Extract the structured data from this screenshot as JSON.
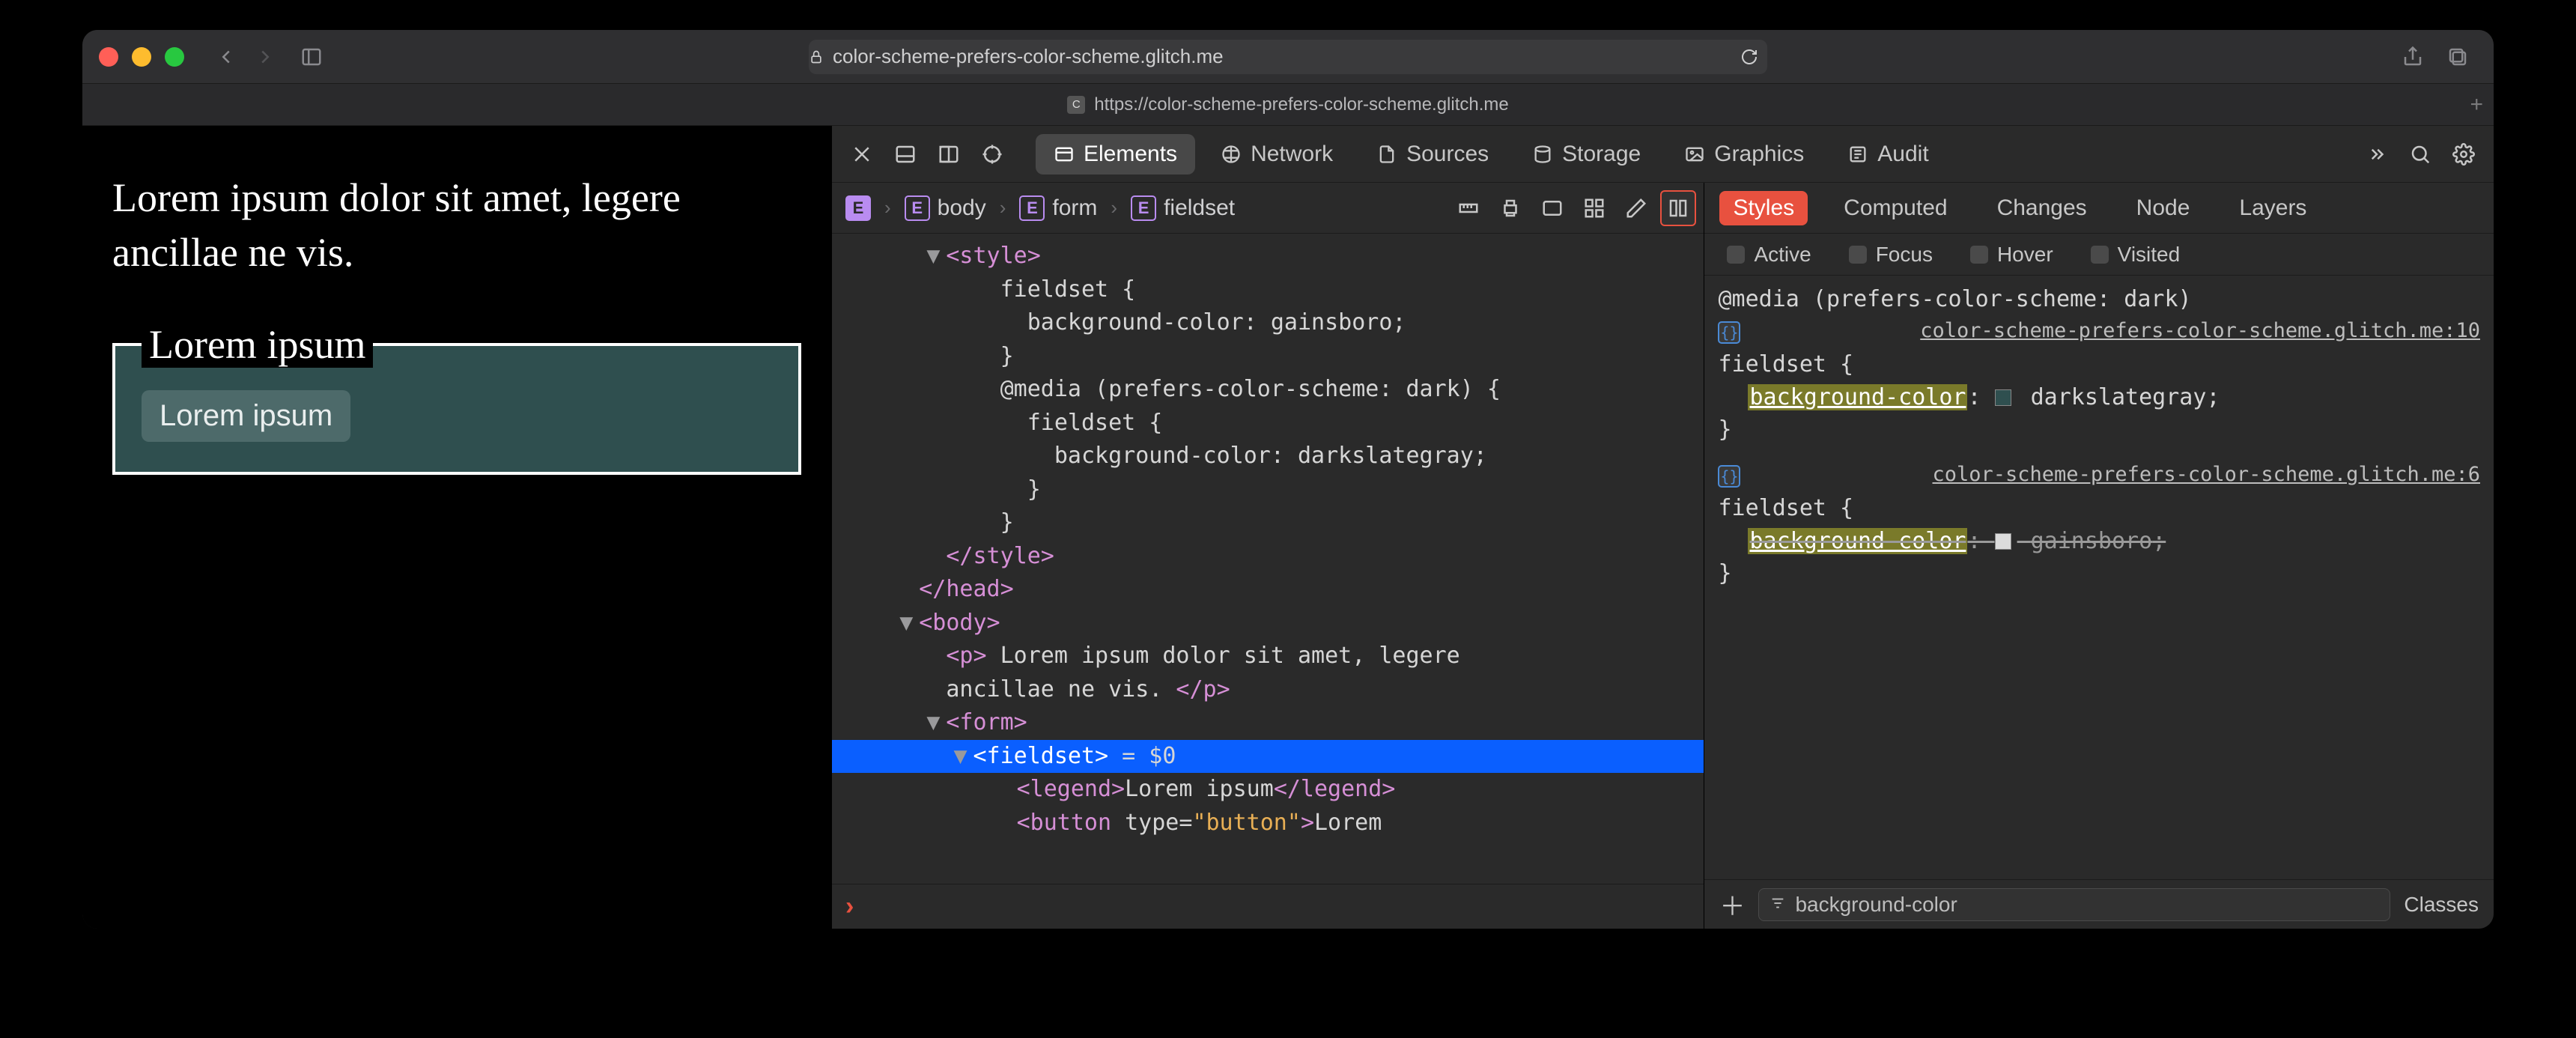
{
  "titlebar": {
    "url_display": "color-scheme-prefers-color-scheme.glitch.me",
    "tab_full_url": "https://color-scheme-prefers-color-scheme.glitch.me",
    "tab_favicon_letter": "C"
  },
  "page": {
    "paragraph": "Lorem ipsum dolor sit amet, legere ancillae ne vis.",
    "legend": "Lorem ipsum",
    "button": "Lorem ipsum"
  },
  "devtools": {
    "tabs": [
      "Elements",
      "Network",
      "Sources",
      "Storage",
      "Graphics",
      "Audit"
    ],
    "active_tab": "Elements",
    "breadcrumb": [
      "",
      "body",
      "form",
      "fieldset"
    ],
    "dom_lines": [
      {
        "indent": 3,
        "disclose": "▼",
        "html": "<span class='tag'>&lt;style&gt;</span>"
      },
      {
        "indent": 5,
        "html": "<span class='txt'>fieldset {</span>"
      },
      {
        "indent": 6,
        "html": "<span class='txt'>background-color: gainsboro;</span>"
      },
      {
        "indent": 5,
        "html": "<span class='txt'>}</span>"
      },
      {
        "indent": 5,
        "html": "<span class='txt'>@media (prefers-color-scheme: dark) {</span>"
      },
      {
        "indent": 6,
        "html": "<span class='txt'>fieldset {</span>"
      },
      {
        "indent": 7,
        "html": "<span class='txt'>background-color: darkslategray;</span>"
      },
      {
        "indent": 6,
        "html": "<span class='txt'>}</span>"
      },
      {
        "indent": 5,
        "html": "<span class='txt'>}</span>"
      },
      {
        "indent": 3,
        "html": "<span class='tag'>&lt;/style&gt;</span>"
      },
      {
        "indent": 2,
        "html": "<span class='tag'>&lt;/head&gt;</span>"
      },
      {
        "indent": 2,
        "disclose": "▼",
        "html": "<span class='tag'>&lt;body&gt;</span>"
      },
      {
        "indent": 3,
        "html": "<span class='tag'>&lt;p&gt;</span><span class='txt'> Lorem ipsum dolor sit amet, legere</span>"
      },
      {
        "indent": 3,
        "html": "<span class='txt'>ancillae ne vis. </span><span class='tag'>&lt;/p&gt;</span>"
      },
      {
        "indent": 3,
        "disclose": "▼",
        "html": "<span class='tag'>&lt;form&gt;</span>"
      },
      {
        "indent": 4,
        "disclose": "▼",
        "selected": true,
        "html": "<span class='tag'>&lt;fieldset&gt;</span><span class='txt'> = $0</span>"
      },
      {
        "indent": 5,
        "gutter": true,
        "html": "<span class='tag'>&lt;legend&gt;</span><span class='txt'>Lorem ipsum</span><span class='tag'>&lt;/legend&gt;</span>"
      },
      {
        "indent": 5,
        "gutter": true,
        "html": "<span class='tag'>&lt;button </span><span class='txt'>type=</span><span class='attr'>\"button\"</span><span class='tag'>&gt;</span><span class='txt'>Lorem</span>"
      }
    ],
    "styles": {
      "tabs": [
        "Styles",
        "Computed",
        "Changes",
        "Node",
        "Layers"
      ],
      "active": "Styles",
      "pseudo": [
        "Active",
        "Focus",
        "Hover",
        "Visited"
      ],
      "media_query": "@media (prefers-color-scheme: dark)",
      "rule1_source": "color-scheme-prefers-color-scheme.glitch.me:10",
      "rule1_selector": "fieldset",
      "rule1_prop": "background-color",
      "rule1_value": "darkslategray",
      "rule1_swatch": "#2f4f4f",
      "rule2_source": "color-scheme-prefers-color-scheme.glitch.me:6",
      "rule2_selector": "fieldset",
      "rule2_prop": "background-color",
      "rule2_value": "gainsboro",
      "rule2_swatch": "#dcdcdc",
      "filter_value": "background-color",
      "classes_btn": "Classes"
    }
  }
}
